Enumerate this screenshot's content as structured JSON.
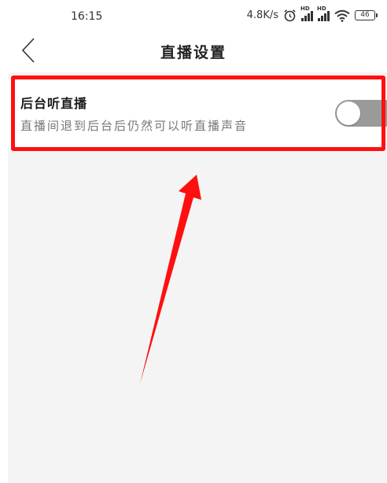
{
  "status_bar": {
    "time": "16:15",
    "net_speed": "4.8K/s",
    "battery": "46",
    "icons": [
      "alarm-icon",
      "signal-hd-icon",
      "signal-hd-icon",
      "wifi-icon",
      "battery-icon"
    ]
  },
  "nav": {
    "title": "直播设置",
    "back_icon": "chevron-left-icon"
  },
  "setting": {
    "title": "后台听直播",
    "description": "直播间退到后台后仍然可以听直播声音",
    "toggle_on": false
  },
  "colors": {
    "highlight": "#ff1010",
    "toggle_off": "#9a9a9a",
    "page_bg": "#f4f4f4"
  }
}
